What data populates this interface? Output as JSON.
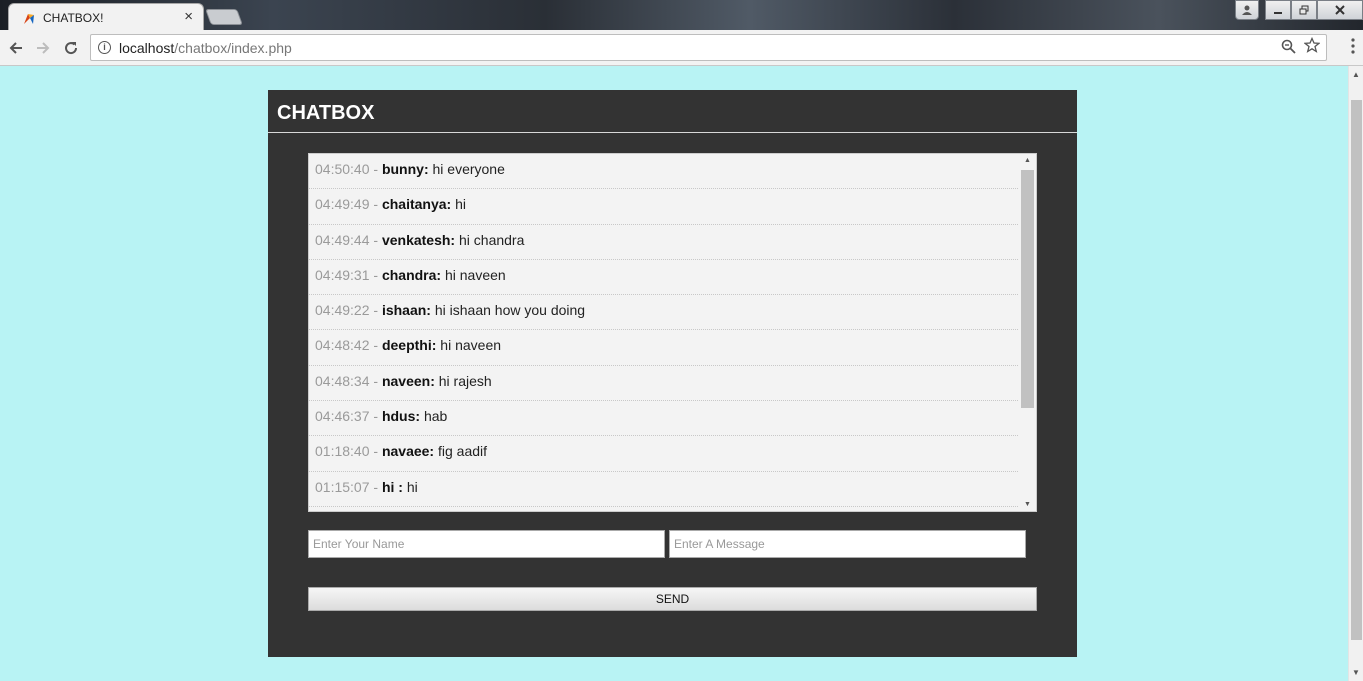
{
  "browser": {
    "tab_title": "CHATBOX!",
    "tab_close": "×",
    "url_host": "localhost",
    "url_path": "/chatbox/index.php",
    "icons": [
      "chrome-favicon",
      "close-icon",
      "back-icon",
      "forward-icon",
      "reload-icon",
      "info-icon",
      "zoom-icon",
      "star-icon",
      "menu-icon"
    ]
  },
  "chat": {
    "title": "CHATBOX",
    "messages": [
      {
        "time": "04:50:40",
        "name": "bunny:",
        "text": "hi everyone"
      },
      {
        "time": "04:49:49",
        "name": "chaitanya:",
        "text": "hi"
      },
      {
        "time": "04:49:44",
        "name": "venkatesh:",
        "text": "hi chandra"
      },
      {
        "time": "04:49:31",
        "name": "chandra:",
        "text": "hi naveen"
      },
      {
        "time": "04:49:22",
        "name": "ishaan:",
        "text": "hi ishaan how you doing"
      },
      {
        "time": "04:48:42",
        "name": "deepthi:",
        "text": "hi naveen"
      },
      {
        "time": "04:48:34",
        "name": "naveen:",
        "text": "hi rajesh"
      },
      {
        "time": "04:46:37",
        "name": "hdus:",
        "text": "hab"
      },
      {
        "time": "01:18:40",
        "name": "navaee:",
        "text": "fig aadif"
      },
      {
        "time": "01:15:07",
        "name": "hi :",
        "text": "hi"
      }
    ],
    "separator": "-",
    "name_placeholder": "Enter Your Name",
    "message_placeholder": "Enter A Message",
    "send_label": "SEND"
  },
  "colors": {
    "page_background": "#b8f3f4",
    "chatbox_background": "#333333",
    "messages_background": "#f3f3f3"
  }
}
